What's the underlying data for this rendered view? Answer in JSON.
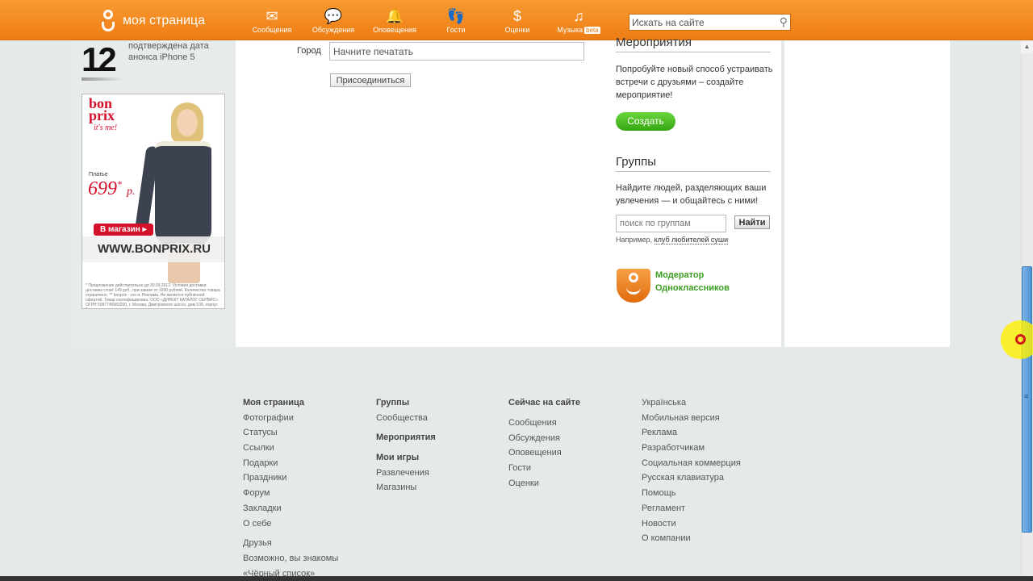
{
  "topbar": {
    "logo_text": "моя страница",
    "nav": [
      {
        "label": "Сообщения",
        "icon": "envelope-icon",
        "glyph": "✉"
      },
      {
        "label": "Обсуждения",
        "icon": "chat-bubbles-icon",
        "glyph": "💬"
      },
      {
        "label": "Оповещения",
        "icon": "bell-icon",
        "glyph": "🔔"
      },
      {
        "label": "Гости",
        "icon": "footprints-icon",
        "glyph": "👣"
      },
      {
        "label": "Оценки",
        "icon": "rating-coins-icon",
        "glyph": "$"
      },
      {
        "label": "Музыка",
        "icon": "music-note-icon",
        "glyph": "♫",
        "badge": "beta"
      }
    ],
    "search_placeholder": "Искать на сайте"
  },
  "left": {
    "news_number": "12",
    "news_text": "подтверждена дата анонса iPhone 5",
    "ad": {
      "brand_line1": "bon",
      "brand_line2": "prix",
      "tagline": "it's me!",
      "dress_label": "Платье",
      "price": "699",
      "price_suffix": "р.",
      "shop_button": "В магазин ▸",
      "url": "WWW.BONPRIX.RU",
      "fine_print": "* Предложение действительно до 30.09.2012. Условия доставки: доставка стоит 149 руб., при заказе от 1990 рублей. Количество товара ограничено. ** bonprix - это я. Реклама. Не является публичной офертой. Товар сертифицирован. ООО «ДИРЕКТ КАТАЛОГ СЕРВИС». ОГРН 5087746583200, г. Москва, Дмитровское шоссе, дом 109, корпус 2."
    }
  },
  "main": {
    "city_label": "Город",
    "city_placeholder": "Начните печатать",
    "join_button": "Присоединиться"
  },
  "sidebar": {
    "events_title": "Мероприятия",
    "events_text": "Попробуйте новый способ устраивать встречи с друзьями – создайте мероприятие!",
    "create_button": "Создать",
    "groups_title": "Группы",
    "groups_text": "Найдите людей, разделяющих ваши увлечения — и общайтесь с ними!",
    "group_search_placeholder": "поиск по группам",
    "find_button": "Найти",
    "example_prefix": "Например,",
    "example_link": "клуб любителей суши",
    "moderator_line1": "Модератор",
    "moderator_line2": "Одноклассников"
  },
  "footer": {
    "col1": [
      "Моя страница",
      "Фотографии",
      "Статусы",
      "Ссылки",
      "Подарки",
      "Праздники",
      "Форум",
      "Закладки",
      "О себе"
    ],
    "col1b": [
      "Друзья",
      "Возможно, вы знакомы",
      "«Чёрный список»"
    ],
    "col2a": [
      "Группы",
      "Сообщества"
    ],
    "col2b": [
      "Мероприятия"
    ],
    "col2c": [
      "Мои игры",
      "Развлечения",
      "Магазины"
    ],
    "col3": [
      "Сейчас на сайте",
      "Сообщения",
      "Обсуждения",
      "Оповещения",
      "Гости",
      "Оценки"
    ],
    "col4": [
      "Українська",
      "Мобильная версия",
      "Реклама",
      "Разработчикам",
      "Социальная коммерция",
      "Русская клавиатура",
      "Помощь",
      "Регламент",
      "Новости",
      "О компании"
    ]
  }
}
